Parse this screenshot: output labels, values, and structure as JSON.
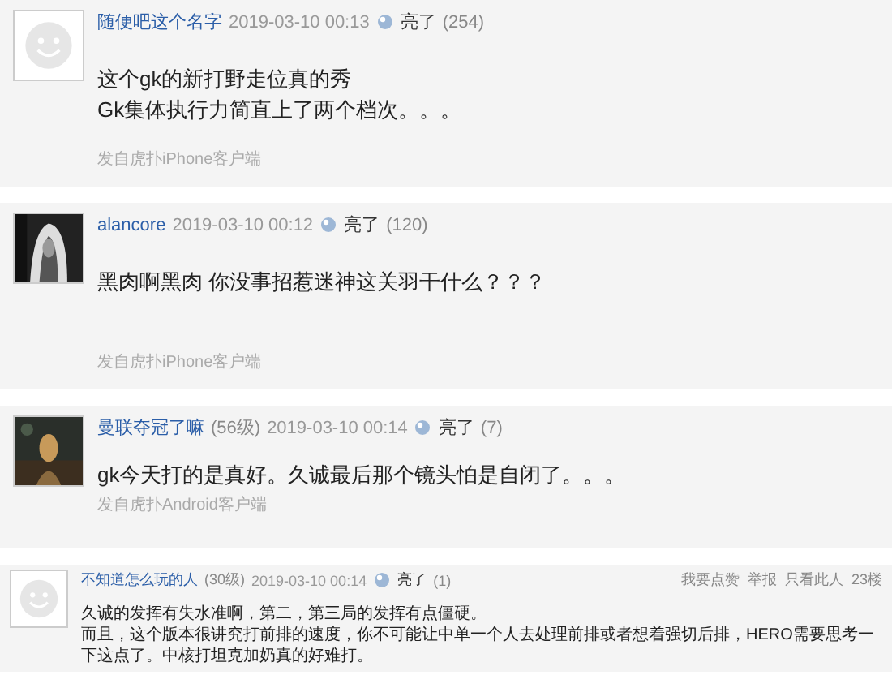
{
  "comments": [
    {
      "kind": "large",
      "avatar": {
        "kind": "default"
      },
      "user": "随便吧这个名字",
      "time": "2019-03-10 00:13",
      "like_label": "亮了",
      "like_count": "(254)",
      "lines": [
        "这个gk的新打野走位真的秀",
        "Gk集体执行力简直上了两个档次。。。"
      ],
      "source": "发自虎扑iPhone客户端"
    },
    {
      "kind": "large",
      "avatar": {
        "kind": "picture"
      },
      "user": "alancore",
      "time": "2019-03-10 00:12",
      "like_label": "亮了",
      "like_count": "(120)",
      "lines": [
        "黑肉啊黑肉 你没事招惹迷神这关羽干什么？？？"
      ],
      "source": "发自虎扑iPhone客户端"
    },
    {
      "kind": "medium",
      "avatar": {
        "kind": "picture"
      },
      "user": "曼联夺冠了嘛",
      "level": "(56级)",
      "time": "2019-03-10 00:14",
      "like_label": "亮了",
      "like_count": "(7)",
      "lines": [
        "gk今天打的是真好。久诚最后那个镜头怕是自闭了。。。"
      ],
      "source": "发自虎扑Android客户端"
    },
    {
      "kind": "small",
      "avatar": {
        "kind": "default"
      },
      "user": "不知道怎么玩的人",
      "level": "(30级)",
      "time": "2019-03-10 00:14",
      "like_label": "亮了",
      "like_count": "(1)",
      "actions": [
        "我要点赞",
        "举报",
        "只看此人"
      ],
      "floor": "23楼",
      "lines": [
        "久诚的发挥有失水准啊，第二，第三局的发挥有点僵硬。",
        "而且，这个版本很讲究打前排的速度，你不可能让中单一个人去处理前排或者想着强切后排，HERO需要思考一下这点了。中核打坦克加奶真的好难打。"
      ]
    }
  ]
}
